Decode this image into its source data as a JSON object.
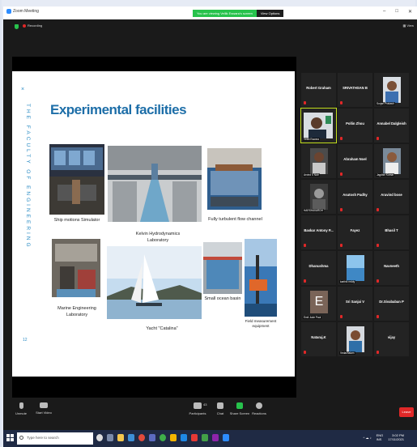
{
  "window": {
    "app_title": "Zoom Meeting",
    "viewing_banner": "You are viewing Vellik Eswara's screen",
    "view_options": "View Options",
    "controls": [
      "–",
      "□",
      "✕"
    ]
  },
  "meeting": {
    "recording_label": "Recording",
    "view_label": "View"
  },
  "slide": {
    "close_glyph": "×",
    "vertical_text": "THE FACULTY OF ENGINEERING",
    "title": "Experimental facilities",
    "page_number": "12",
    "captions": {
      "ship_motions": "Ship motions Simulator",
      "kelvin": "Kelvin Hydrodynamics Laboratory",
      "flow_channel": "Fully turbulent flow channel",
      "marine_lab": "Marine Engineering Laboratory",
      "yacht": "Yacht \"Catalina\"",
      "ocean_basin": "Small ocean basin",
      "field_equipment": "Field measurement equipment"
    }
  },
  "gallery": {
    "tiles": [
      {
        "name": "Robert Graham",
        "label": ""
      },
      {
        "name": "SRIVATHSAN B",
        "label": ""
      },
      {
        "name": "",
        "label": "Surjan Prakash"
      },
      {
        "name": "",
        "label": "Vellik Eswara"
      },
      {
        "name": "Pollin Zhou",
        "label": ""
      },
      {
        "name": "Annabel Dalgleish",
        "label": ""
      },
      {
        "name": "",
        "label": "Arvind S Nair"
      },
      {
        "name": "Abraham Noel",
        "label": ""
      },
      {
        "name": "",
        "label": "Jagdish Kumar"
      },
      {
        "name": "",
        "label": "HARSHAVARDH"
      },
      {
        "name": "Asutosh Padhy",
        "label": ""
      },
      {
        "name": "Aravind bose",
        "label": ""
      },
      {
        "name": "Baskar Antony P...",
        "label": ""
      },
      {
        "name": "Fayez",
        "label": ""
      },
      {
        "name": "Bhasil T",
        "label": ""
      },
      {
        "name": "Dhanushma",
        "label": ""
      },
      {
        "name": "",
        "label": "karthik reddy"
      },
      {
        "name": "Navneeth",
        "label": ""
      },
      {
        "name": "",
        "label": "Emil Jude Paul"
      },
      {
        "name": "Sri Sanjai V",
        "label": ""
      },
      {
        "name": "Dr.Sivababan P",
        "label": ""
      },
      {
        "name": "Nataraj.K",
        "label": ""
      },
      {
        "name": "",
        "label": "Vedachalam"
      },
      {
        "name": "vijay",
        "label": ""
      }
    ],
    "avatar_letter": "E",
    "pager_glyph": "⌄"
  },
  "toolbar": {
    "unmute": "Unmute",
    "start_video": "Start Video",
    "participants": "Participants",
    "participants_count": "43",
    "chat": "Chat",
    "share_screen": "Share Screen",
    "reactions": "Reactions",
    "leave": "Leave"
  },
  "taskbar": {
    "search_placeholder": "Type here to search",
    "language": "ENG\nINS",
    "time": "3:02 PM",
    "date": "17/11/2021"
  },
  "colors": {
    "accent_blue": "#1d6ea8",
    "green": "#27c24c",
    "red": "#e02828"
  }
}
